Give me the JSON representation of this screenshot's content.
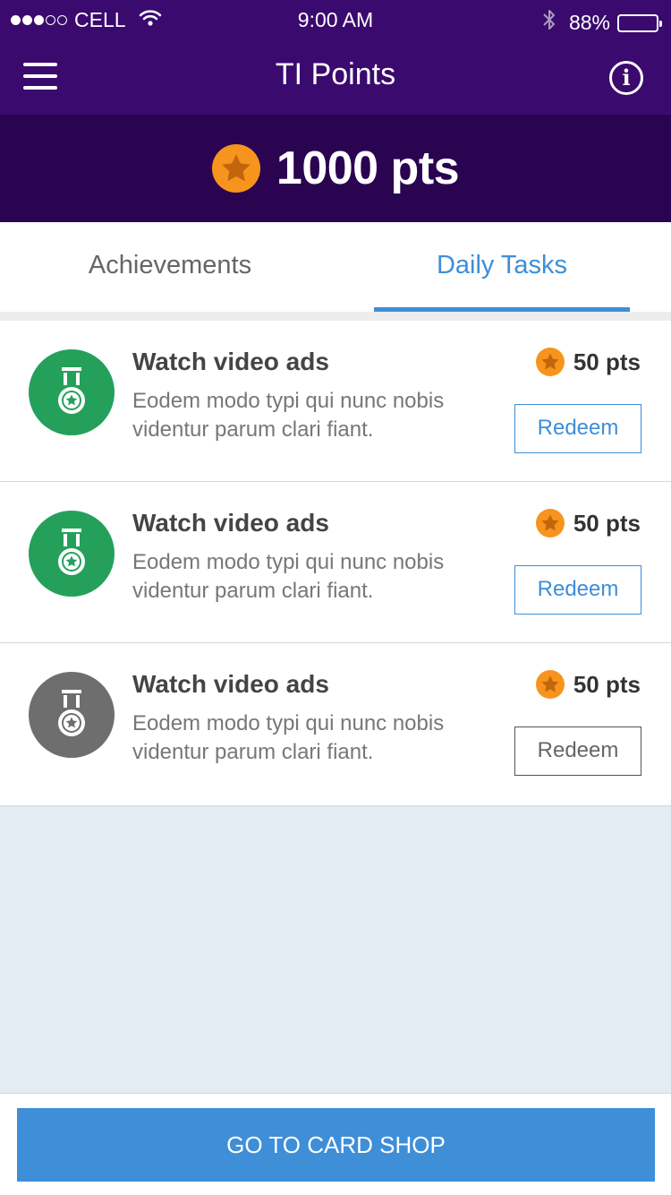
{
  "status_bar": {
    "carrier": "CELL",
    "time": "9:00 AM",
    "battery": "88%",
    "signal_bars_filled": 3,
    "signal_bars_total": 5,
    "battery_level": 0.88
  },
  "nav": {
    "title": "TI Points",
    "menu_icon": "hamburger-menu-icon",
    "info_icon": "info-icon",
    "info_glyph": "i"
  },
  "points": {
    "value": "1000 pts",
    "icon": "star-coin-icon"
  },
  "tabs": [
    {
      "label": "Achievements",
      "active": false
    },
    {
      "label": "Daily Tasks",
      "active": true
    }
  ],
  "tasks": [
    {
      "title": "Watch video ads",
      "description": "Eodem modo typi qui nunc nobis videntur parum clari fiant.",
      "reward": "50 pts",
      "button": "Redeem",
      "badge_color": "#24a05b",
      "enabled": true
    },
    {
      "title": "Watch video ads",
      "description": "Eodem modo typi qui nunc nobis videntur parum clari fiant.",
      "reward": "50 pts",
      "button": "Redeem",
      "badge_color": "#24a05b",
      "enabled": true
    },
    {
      "title": "Watch video ads",
      "description": "Eodem modo typi qui nunc nobis videntur parum clari fiant.",
      "reward": "50 pts",
      "button": "Redeem",
      "badge_color": "#6e6e6e",
      "enabled": false
    }
  ],
  "cta": {
    "label": "GO TO CARD SHOP"
  },
  "colors": {
    "header": "#3b0a6e",
    "points_bar": "#2a0450",
    "accent": "#3e8ed8",
    "coin": "#f7941d",
    "badge_active": "#24a05b",
    "badge_inactive": "#6e6e6e",
    "background": "#e3ebf3"
  }
}
